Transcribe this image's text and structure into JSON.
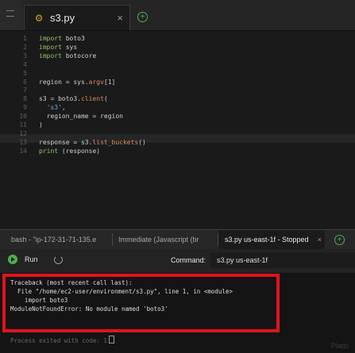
{
  "editor_tab": {
    "name": "s3.py",
    "close": "×",
    "add": "+"
  },
  "code": [
    {
      "n": "1",
      "parts": [
        [
          "kw",
          "import"
        ],
        [
          "plain",
          " boto3"
        ]
      ]
    },
    {
      "n": "2",
      "parts": [
        [
          "kw",
          "import"
        ],
        [
          "plain",
          " sys"
        ]
      ]
    },
    {
      "n": "3",
      "parts": [
        [
          "kw",
          "import"
        ],
        [
          "plain",
          " botocore"
        ]
      ]
    },
    {
      "n": "4",
      "parts": []
    },
    {
      "n": "5",
      "parts": []
    },
    {
      "n": "6",
      "parts": [
        [
          "plain",
          "region = sys."
        ],
        [
          "fn",
          "argv"
        ],
        [
          "plain",
          "[1]"
        ]
      ]
    },
    {
      "n": "7",
      "parts": []
    },
    {
      "n": "8",
      "parts": [
        [
          "plain",
          "s3 = boto3."
        ],
        [
          "fn",
          "client"
        ],
        [
          "plain",
          "("
        ]
      ]
    },
    {
      "n": "9",
      "parts": [
        [
          "plain",
          "  "
        ],
        [
          "str",
          "'s3'"
        ],
        [
          "plain",
          ","
        ]
      ]
    },
    {
      "n": "10",
      "parts": [
        [
          "plain",
          "  region_name = region"
        ]
      ]
    },
    {
      "n": "11",
      "parts": [
        [
          "plain",
          ")"
        ]
      ]
    },
    {
      "n": "12",
      "parts": []
    },
    {
      "n": "13",
      "parts": [
        [
          "plain",
          "response = s3."
        ],
        [
          "fn",
          "list_buckets"
        ],
        [
          "plain",
          "()"
        ]
      ]
    },
    {
      "n": "14",
      "parts": [
        [
          "kw",
          "print"
        ],
        [
          "plain",
          " (response)"
        ]
      ]
    }
  ],
  "panel_tabs": [
    {
      "label": "bash - \"ip-172-31-71-135.e"
    },
    {
      "label": "Immediate (Javascript (br"
    },
    {
      "label": "s3.py us-east-1f - Stopped",
      "close": "×"
    }
  ],
  "panel_add": "+",
  "runbar": {
    "run": "Run",
    "command_label": "Command:",
    "command_value": "s3.py us-east-1f"
  },
  "terminal": {
    "lines": [
      "Traceback (most recent call last):",
      "  File \"/home/ec2-user/environment/s3.py\", line 1, in <module>",
      "    import boto3",
      "ModuleNotFoundError: No module named 'boto3'"
    ],
    "exit": "Process exited with code: 1"
  },
  "watermark": "Platzi",
  "colors": {
    "keyword": "#8fc16c",
    "function": "#d98c5f",
    "string": "#6aaee0",
    "error_box": "#e0141c",
    "run": "#4caf50"
  }
}
